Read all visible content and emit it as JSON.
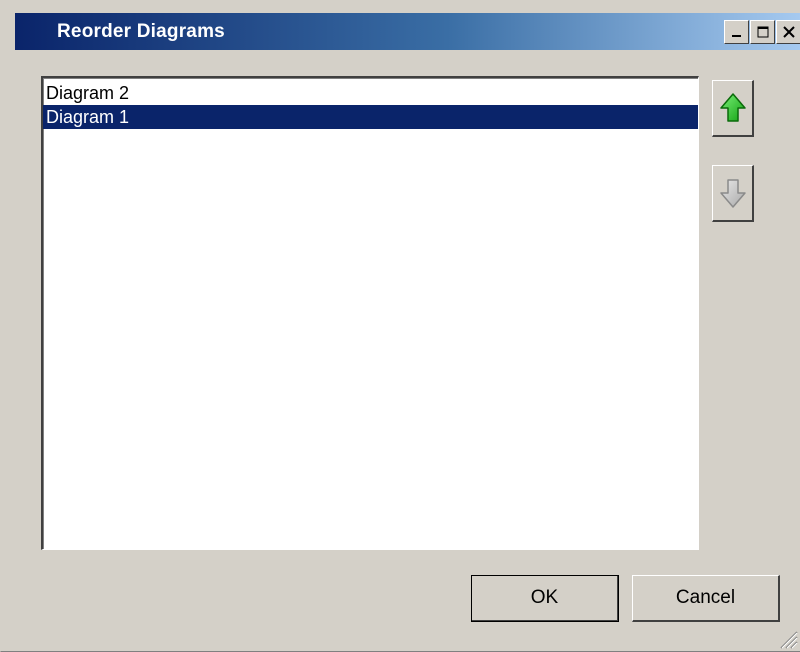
{
  "window": {
    "title": "Reorder Diagrams",
    "controls": {
      "minimize_icon": "minimize-icon",
      "maximize_icon": "maximize-icon",
      "close_icon": "close-icon"
    }
  },
  "list": {
    "items": [
      {
        "label": "Diagram 2",
        "selected": false
      },
      {
        "label": "Diagram 1",
        "selected": true
      }
    ]
  },
  "side_buttons": {
    "move_up_icon": "green-up-arrow-icon",
    "move_down_icon": "gray-down-arrow-icon",
    "move_down_enabled": false
  },
  "footer": {
    "ok_label": "OK",
    "cancel_label": "Cancel"
  },
  "colors": {
    "titlebar_start": "#0a246a",
    "titlebar_end": "#a6caf0",
    "selection": "#0a246a",
    "dialog_bg": "#d4d0c8",
    "up_arrow": "#22c020",
    "down_arrow_disabled": "#b0b0b0"
  }
}
